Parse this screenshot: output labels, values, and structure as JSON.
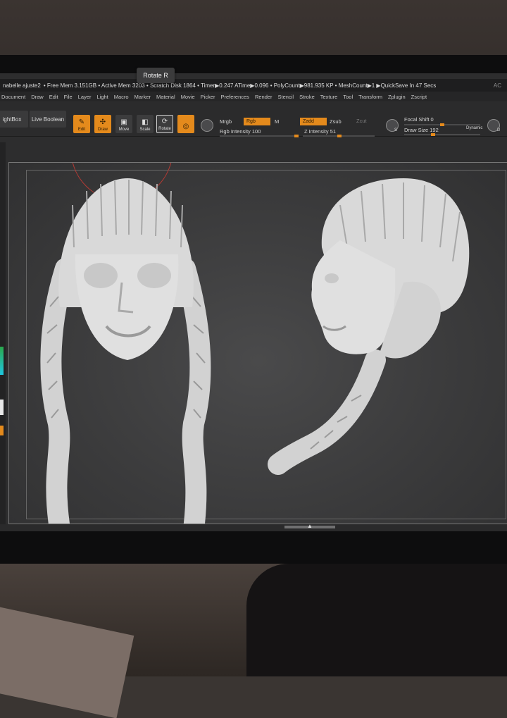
{
  "app": {
    "title": "nabelle ajuste2",
    "status": "• Free Mem 3.151GB • Active Mem 3203 • Scratch Disk 1864 • Timer▶0.247 ATime▶0.096 • PolyCount▶981.935 KP • MeshCount▶1 ▶QuickSave In 47 Secs",
    "corner": "AC"
  },
  "menu": [
    "Document",
    "Draw",
    "Edit",
    "File",
    "Layer",
    "Light",
    "Macro",
    "Marker",
    "Material",
    "Movie",
    "Picker",
    "Preferences",
    "Render",
    "Stencil",
    "Stroke",
    "Texture",
    "Tool",
    "Transform",
    "Zplugin",
    "Zscript"
  ],
  "toolbar": {
    "lightbox": "ightBox",
    "live_boolean": "Live Boolean",
    "edit": "Edit",
    "draw": "Draw",
    "move": "Move",
    "scale": "Scale",
    "rotate": "Rotate",
    "mrgb": "Mrgb",
    "rgb": "Rgb",
    "m": "M",
    "rgb_intensity": "Rgb Intensity 100",
    "zadd": "Zadd",
    "zsub": "Zsub",
    "zcut": "Zcut",
    "z_intensity": "Z Intensity 51",
    "focal_shift": "Focal Shift 0",
    "draw_size": "Draw Size 192",
    "dynamic": "Dynamic",
    "s_label": "S",
    "d_label": "D"
  },
  "progress": {
    "rgb_intensity": 1.0,
    "z_intensity": 0.51,
    "focal_shift": 0.5,
    "draw_size": 0.38
  },
  "tooltip": "Rotate  R",
  "note": "",
  "colors": {
    "accent": "#e48a1c",
    "viewport": "#3b3b3c",
    "sculpt": "#d8d8d8"
  }
}
